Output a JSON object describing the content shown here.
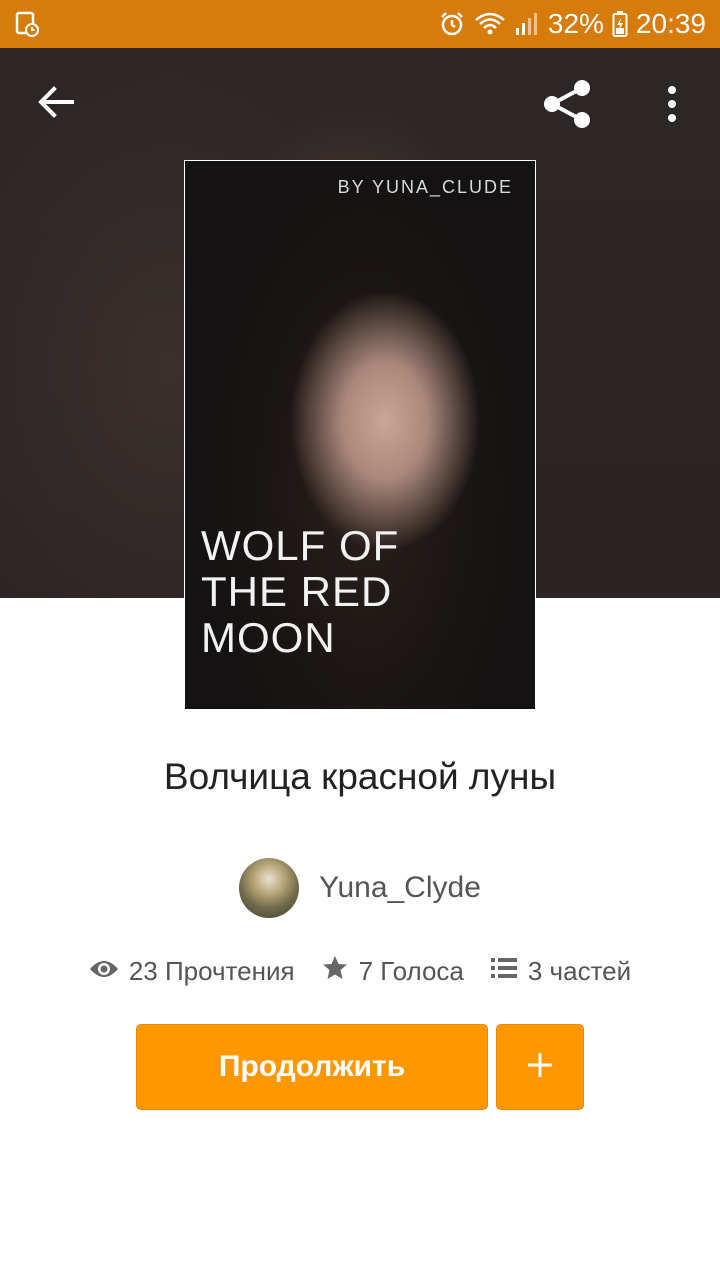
{
  "status_bar": {
    "battery": "32%",
    "time": "20:39",
    "icons": [
      "screen-recorder-icon",
      "alarm-icon",
      "wifi-icon",
      "signal-icon",
      "battery-icon"
    ]
  },
  "toolbar": {
    "icons": [
      "back-arrow-icon",
      "share-icon",
      "more-vert-icon"
    ]
  },
  "cover": {
    "byline": "BY YUNA_CLUDE",
    "title": "WOLF OF\nTHE RED\nMOON"
  },
  "story": {
    "title": "Волчица красной луны",
    "author": "Yuna_Clyde",
    "stats": {
      "reads": "23 Прочтения",
      "votes": "7 Голоса",
      "parts": "3 частей"
    }
  },
  "actions": {
    "continue_label": "Продолжить",
    "add_icon": "plus-icon"
  },
  "colors": {
    "status_bar": "#d77b0a",
    "accent": "#ff9800",
    "text_primary": "#222222",
    "text_secondary": "#555555"
  }
}
